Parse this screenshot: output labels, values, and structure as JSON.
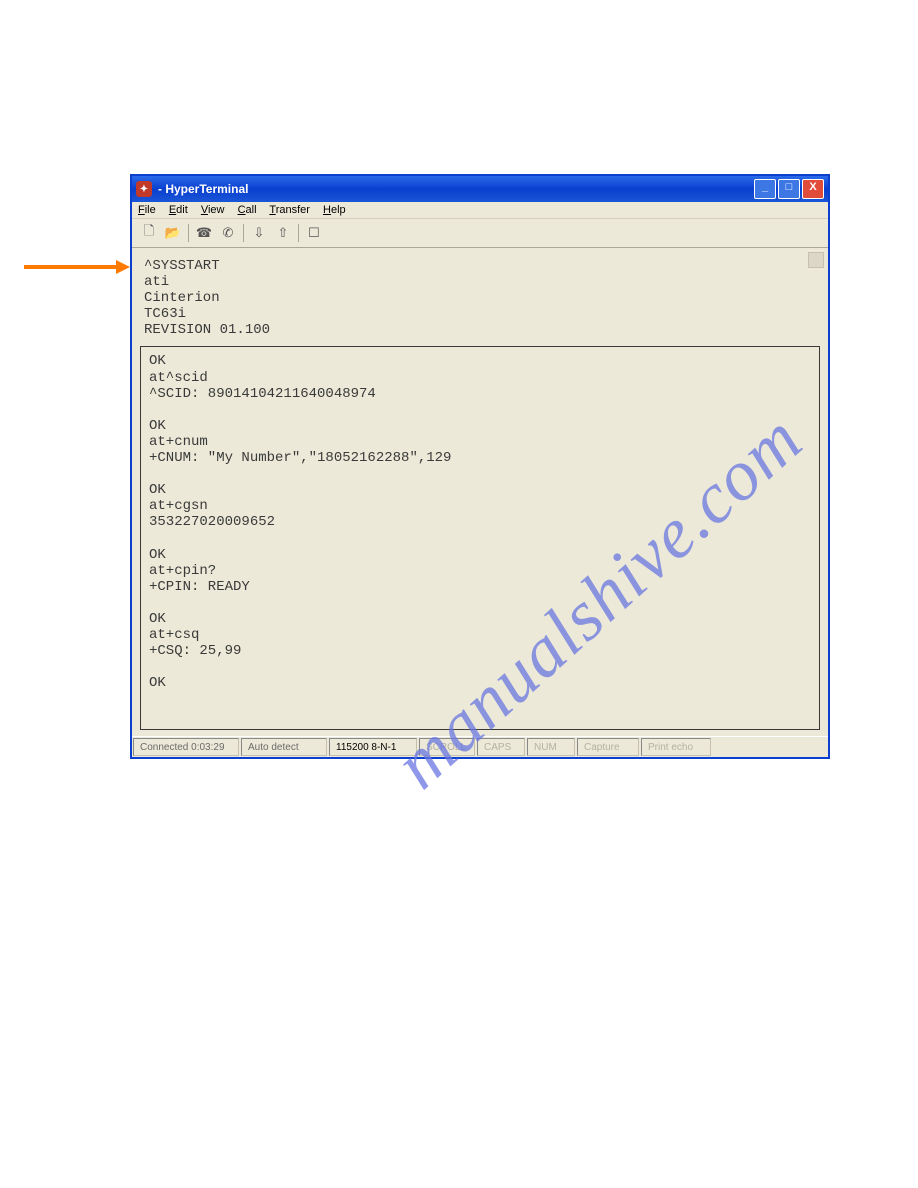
{
  "window": {
    "title": " - HyperTerminal"
  },
  "menu": {
    "file": "File",
    "edit": "Edit",
    "view": "View",
    "call": "Call",
    "transfer": "Transfer",
    "help": "Help"
  },
  "toolbar_icons": {
    "new": "🗋",
    "open": "📂",
    "call": "☎",
    "hang": "✆",
    "send": "⇩",
    "recv": "⇧",
    "props": "☐"
  },
  "terminal": {
    "header": "^SYSSTART\nati\nCinterion\nTC63i\nREVISION 01.100",
    "body": "OK\nat^scid\n^SCID: 89014104211640048974\n\nOK\nat+cnum\n+CNUM: \"My Number\",\"18052162288\",129\n\nOK\nat+cgsn\n353227020009652\n\nOK\nat+cpin?\n+CPIN: READY\n\nOK\nat+csq\n+CSQ: 25,99\n\nOK\n"
  },
  "status": {
    "connected": "Connected 0:03:29",
    "detect": "Auto detect",
    "baud": "115200 8-N-1",
    "scroll": "SCROLL",
    "caps": "CAPS",
    "num": "NUM",
    "capture": "Capture",
    "echo": "Print echo"
  },
  "watermark": "manualshive.com"
}
